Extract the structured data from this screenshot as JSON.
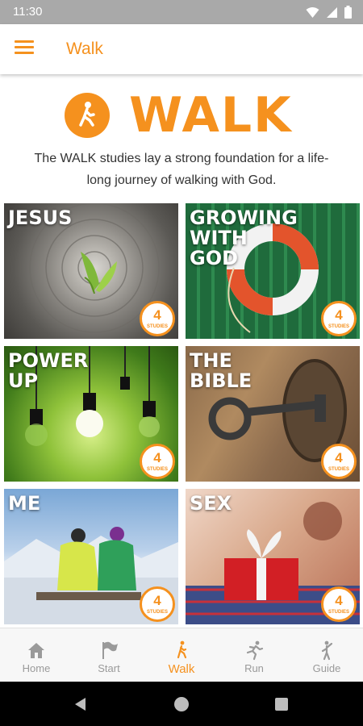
{
  "status": {
    "time": "11:30"
  },
  "app_bar": {
    "title": "Walk"
  },
  "hero": {
    "title": "WALK",
    "description": "The WALK studies lay a strong foundation for a life-long journey of walking with God."
  },
  "tiles": [
    {
      "label": "JESUS",
      "count": "4",
      "unit": "STUDIES"
    },
    {
      "label": "GROWING\nWITH\nGOD",
      "count": "4",
      "unit": "STUDIES"
    },
    {
      "label": "POWER\nUP",
      "count": "4",
      "unit": "STUDIES"
    },
    {
      "label": "THE\nBIBLE",
      "count": "4",
      "unit": "STUDIES"
    },
    {
      "label": "ME",
      "count": "4",
      "unit": "STUDIES"
    },
    {
      "label": "SEX",
      "count": "4",
      "unit": "STUDIES"
    }
  ],
  "bottom_nav": [
    {
      "label": "Home",
      "icon": "home-icon"
    },
    {
      "label": "Start",
      "icon": "flag-icon"
    },
    {
      "label": "Walk",
      "icon": "walk-icon",
      "active": true
    },
    {
      "label": "Run",
      "icon": "run-icon"
    },
    {
      "label": "Guide",
      "icon": "guide-icon"
    }
  ],
  "colors": {
    "accent": "#f5911e",
    "nav_inactive": "#9a9a9a"
  }
}
